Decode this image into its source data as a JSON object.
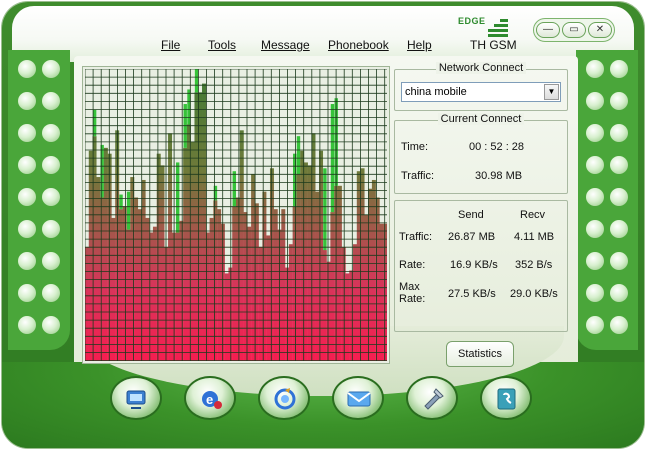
{
  "menu": {
    "file": "File",
    "tools": "Tools",
    "message": "Message",
    "phonebook": "Phonebook",
    "help": "Help"
  },
  "network_indicator": {
    "technology": "EDGE",
    "operator": "TH GSM"
  },
  "window_buttons": {
    "minimize": "—",
    "restore": "▭",
    "close": "✕"
  },
  "network_connect": {
    "title": "Network Connect",
    "selected_profile": "china mobile",
    "arrow": "▼"
  },
  "current_connect": {
    "title": "Current Connect",
    "time_label": "Time:",
    "time_value": "00 : 52 : 28",
    "traffic_label": "Traffic:",
    "traffic_value": "30.98 MB"
  },
  "stats": {
    "send_header": "Send",
    "recv_header": "Recv",
    "traffic_label": "Traffic:",
    "traffic_send": "26.87 MB",
    "traffic_recv": "4.11 MB",
    "rate_label": "Rate:",
    "rate_send": "16.9 KB/s",
    "rate_recv": "352 B/s",
    "max_rate_label_1": "Max",
    "max_rate_label_2": "Rate:",
    "max_send": "27.5 KB/s",
    "max_recv": "29.0 KB/s"
  },
  "statistics_button": "Statistics",
  "colors": {
    "frame_green": "#3f8c2d",
    "grid_line": "#1c3a1c",
    "graph_bottom": "#ef1f52",
    "graph_top": "#4e7d3a",
    "peak_green": "#36c33a"
  },
  "bottom_toolbar": [
    "connect-icon",
    "internet-explorer-icon",
    "update-icon",
    "sms-icon",
    "settings-icon",
    "phonebook-icon"
  ],
  "traffic_graph": {
    "levels": [
      0.39,
      0.72,
      0.77,
      0.63,
      0.56,
      0.73,
      0.71,
      0.49,
      0.79,
      0.52,
      0.53,
      0.45,
      0.63,
      0.56,
      0.52,
      0.62,
      0.49,
      0.44,
      0.46,
      0.71,
      0.67,
      0.39,
      0.78,
      0.44,
      0.44,
      0.48,
      0.73,
      0.81,
      0.75,
      0.92,
      0.92,
      0.95,
      0.44,
      0.49,
      0.55,
      0.52,
      0.47,
      0.3,
      0.32,
      0.53,
      0.56,
      0.79,
      0.51,
      0.46,
      0.64,
      0.54,
      0.39,
      0.58,
      0.43,
      0.66,
      0.52,
      0.45,
      0.52,
      0.32,
      0.4,
      0.53,
      0.64,
      0.72,
      0.68,
      0.67,
      0.78,
      0.58,
      0.72,
      0.38,
      0.34,
      0.51,
      0.6,
      0.6,
      0.39,
      0.3,
      0.31,
      0.4,
      0.65,
      0.66,
      0.5,
      0.59,
      0.62,
      0.56,
      0.47,
      0.47
    ],
    "peaks": [
      0.0,
      0.72,
      0.86,
      0.0,
      0.74,
      0.0,
      0.0,
      0.0,
      0.0,
      0.57,
      0.0,
      0.58,
      0.0,
      0.0,
      0.0,
      0.0,
      0.0,
      0.0,
      0.0,
      0.0,
      0.0,
      0.0,
      0.7,
      0.0,
      0.68,
      0.0,
      0.88,
      0.93,
      0.0,
      1.0,
      0.0,
      0.0,
      0.0,
      0.0,
      0.6,
      0.0,
      0.0,
      0.0,
      0.0,
      0.65,
      0.0,
      0.0,
      0.0,
      0.0,
      0.0,
      0.0,
      0.0,
      0.0,
      0.0,
      0.0,
      0.0,
      0.0,
      0.0,
      0.0,
      0.0,
      0.71,
      0.77,
      0.0,
      0.0,
      0.0,
      0.0,
      0.0,
      0.0,
      0.66,
      0.0,
      0.88,
      0.9,
      0.0,
      0.0,
      0.0,
      0.0,
      0.0,
      0.0,
      0.0,
      0.0,
      0.0,
      0.0,
      0.0,
      0.0,
      0.0
    ]
  }
}
